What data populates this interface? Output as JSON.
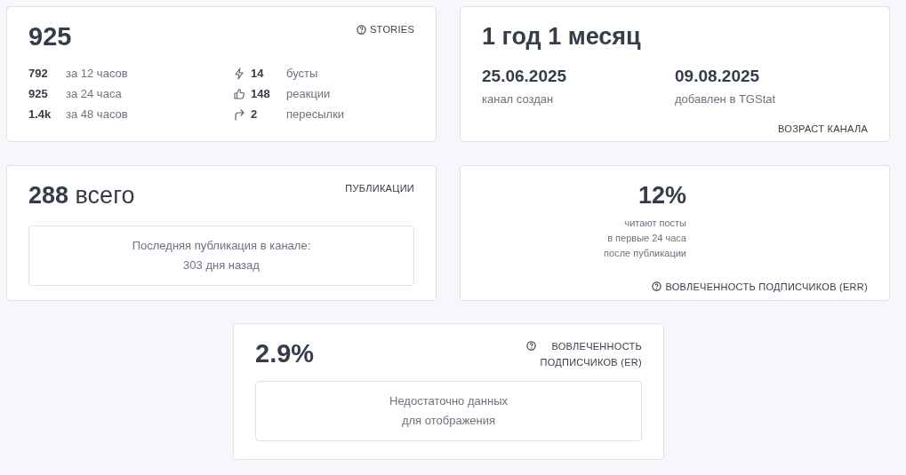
{
  "stories": {
    "value": "925",
    "label": "STORIES",
    "periods": [
      {
        "value": "792",
        "label": "за 12 часов"
      },
      {
        "value": "925",
        "label": "за 24 часа"
      },
      {
        "value": "1.4k",
        "label": "за 48 часов"
      }
    ],
    "metrics": [
      {
        "kind": "boosts",
        "value": "14",
        "label": "бусты"
      },
      {
        "kind": "reactions",
        "value": "148",
        "label": "реакции"
      },
      {
        "kind": "forwards",
        "value": "2",
        "label": "пересылки"
      }
    ]
  },
  "age": {
    "value": "1 год 1 месяц",
    "dates": [
      {
        "value": "25.06.2025",
        "label": "канал создан"
      },
      {
        "value": "09.08.2025",
        "label": "добавлен в TGStat"
      }
    ],
    "label": "ВОЗРАСТ КАНАЛА"
  },
  "publications": {
    "value": "288",
    "unit": "всего",
    "label": "ПУБЛИКАЦИИ",
    "note": [
      "Последняя публикация в канале:",
      "303 дня назад"
    ]
  },
  "err": {
    "value": "12%",
    "description": [
      "читают посты",
      "в первые 24 часа",
      "после публикации"
    ],
    "label": "ВОВЛЕЧЕННОСТЬ ПОДПИСЧИКОВ (ERR)"
  },
  "er": {
    "value": "2.9%",
    "label": [
      "ВОВЛЕЧЕННОСТЬ",
      "ПОДПИСЧИКОВ (ER)"
    ],
    "note": [
      "Недостаточно данных",
      "для отображения"
    ]
  }
}
